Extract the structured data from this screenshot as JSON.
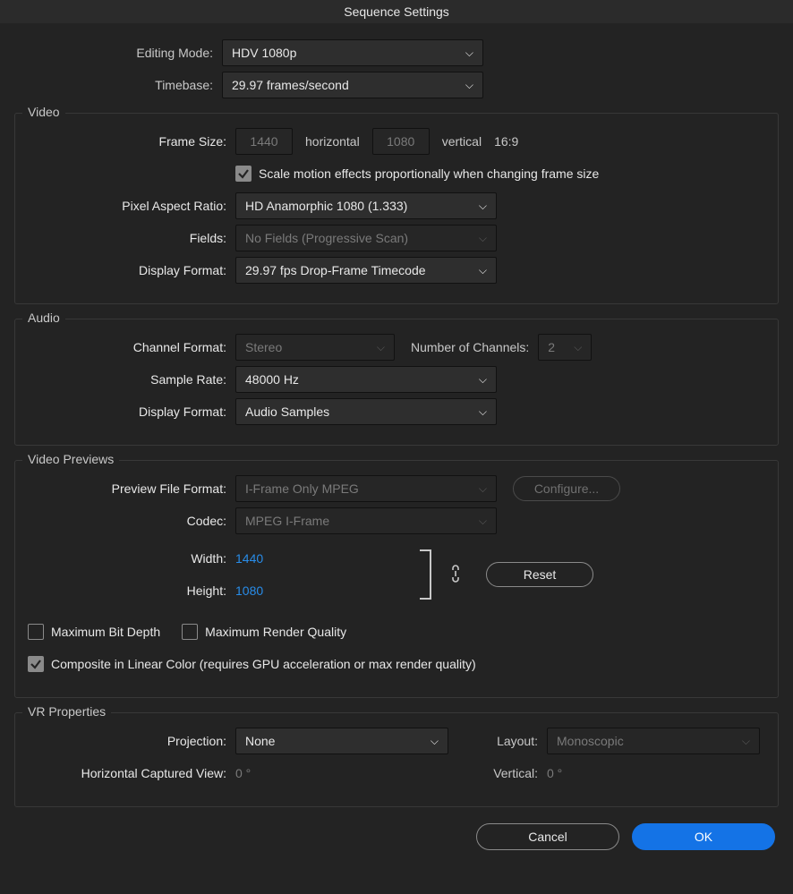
{
  "title": "Sequence Settings",
  "top": {
    "editing_mode_label": "Editing Mode:",
    "editing_mode_value": "HDV 1080p",
    "timebase_label": "Timebase:",
    "timebase_value": "29.97  frames/second"
  },
  "video": {
    "legend": "Video",
    "frame_size_label": "Frame Size:",
    "frame_w": "1440",
    "horizontal": "horizontal",
    "frame_h": "1080",
    "vertical": "vertical",
    "aspect": "16:9",
    "scale_motion_label": "Scale motion effects proportionally when changing frame size",
    "par_label": "Pixel Aspect Ratio:",
    "par_value": "HD Anamorphic 1080 (1.333)",
    "fields_label": "Fields:",
    "fields_value": "No Fields (Progressive Scan)",
    "display_format_label": "Display Format:",
    "display_format_value": "29.97 fps Drop-Frame Timecode"
  },
  "audio": {
    "legend": "Audio",
    "channel_format_label": "Channel Format:",
    "channel_format_value": "Stereo",
    "num_channels_label": "Number of Channels:",
    "num_channels_value": "2",
    "sample_rate_label": "Sample Rate:",
    "sample_rate_value": "48000 Hz",
    "display_format_label": "Display Format:",
    "display_format_value": "Audio Samples"
  },
  "previews": {
    "legend": "Video Previews",
    "preview_format_label": "Preview File Format:",
    "preview_format_value": "I-Frame Only MPEG",
    "configure_label": "Configure...",
    "codec_label": "Codec:",
    "codec_value": "MPEG I-Frame",
    "width_label": "Width:",
    "width_value": "1440",
    "height_label": "Height:",
    "height_value": "1080",
    "reset_label": "Reset",
    "max_bit_depth_label": "Maximum Bit Depth",
    "max_render_quality_label": "Maximum Render Quality",
    "composite_label": "Composite in Linear Color (requires GPU acceleration or max render quality)"
  },
  "vr": {
    "legend": "VR Properties",
    "projection_label": "Projection:",
    "projection_value": "None",
    "layout_label": "Layout:",
    "layout_value": "Monoscopic",
    "horiz_view_label": "Horizontal Captured View:",
    "horiz_view_value": "0 °",
    "vert_label": "Vertical:",
    "vert_value": "0 °"
  },
  "footer": {
    "cancel": "Cancel",
    "ok": "OK"
  }
}
